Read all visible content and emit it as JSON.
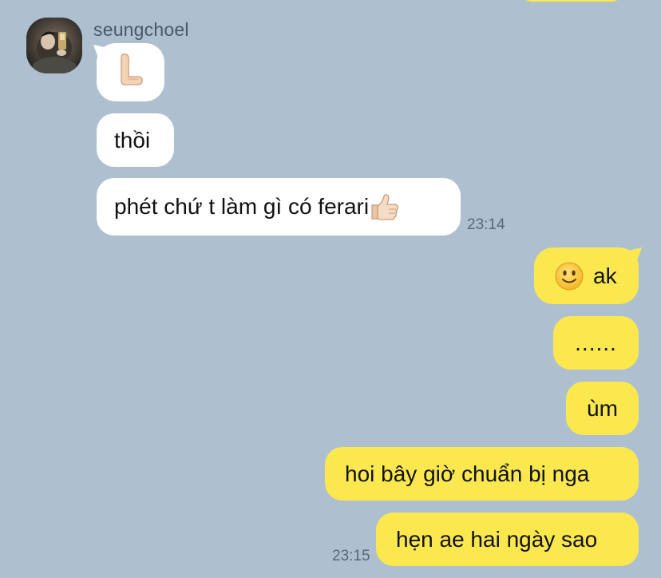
{
  "chat": {
    "contact_name": "seungchoel",
    "messages_in": [
      {
        "text": "",
        "emoji": "hand-l-emoji"
      },
      {
        "text": "thồi"
      },
      {
        "text": "phét chứ t làm gì có ferari",
        "emoji": "thumbs-up-emoji"
      }
    ],
    "time_in": "23:14",
    "messages_out": [
      {
        "text": "ak",
        "emoji": "slightly-smiling-face-emoji"
      },
      {
        "text": "......"
      },
      {
        "text": "ùm"
      },
      {
        "text": "hoi bây giờ chuẩn bị nga"
      },
      {
        "text": "hẹn ae hai ngày sao"
      }
    ],
    "time_out": "23:15"
  },
  "colors": {
    "background": "#aebfd0",
    "incoming_bubble": "#ffffff",
    "outgoing_bubble": "#fbe84f",
    "timestamp": "#5a6876",
    "name": "#4a5866"
  }
}
